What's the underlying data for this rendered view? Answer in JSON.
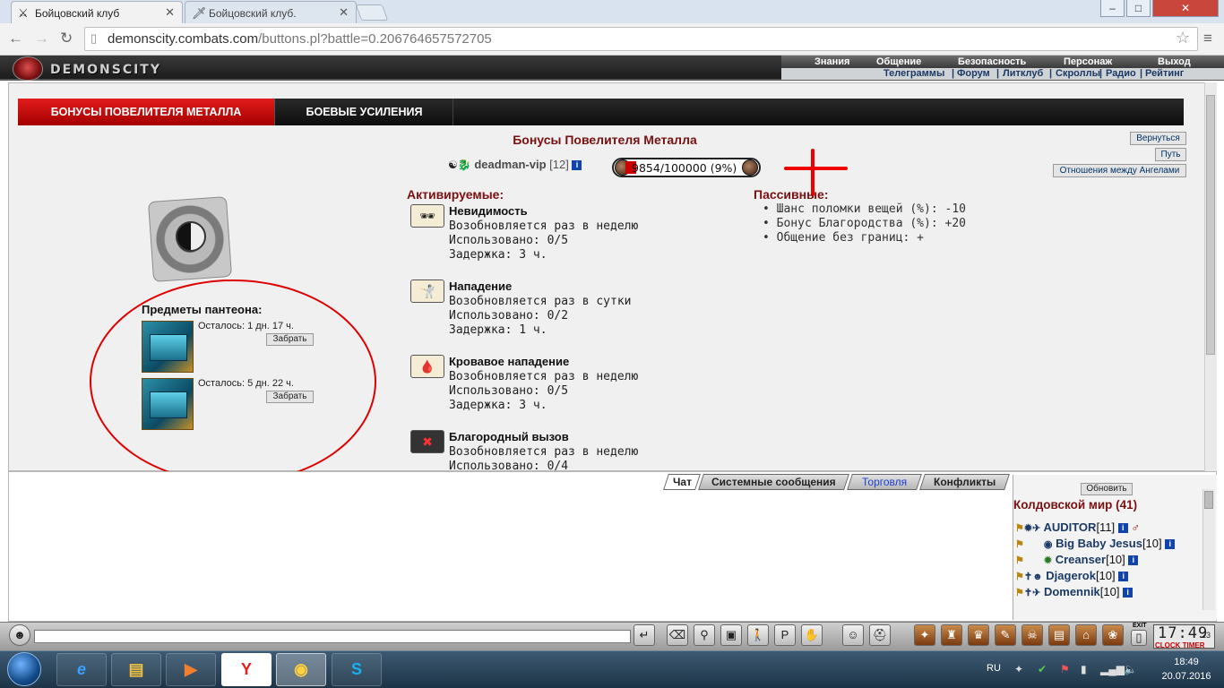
{
  "browser": {
    "tabs": [
      {
        "label": "Бойцовский клуб",
        "icon": "crossed-swords-icon"
      },
      {
        "label": "Бойцовский клуб.",
        "icon": "sword-favicon-icon"
      }
    ],
    "url_host": "demonscity.combats.com",
    "url_path": "/buttons.pl?battle=0.206764657572705",
    "window_controls": {
      "minimize": "–",
      "maximize": "□",
      "close": "✕"
    }
  },
  "site": {
    "logo_text": "DEMONSCITY",
    "menu_top": [
      "Знания",
      "Общение",
      "Безопасность",
      "Персонаж",
      "Выход"
    ],
    "menu_bottom": [
      "Телеграммы",
      "|",
      "Форум",
      "|",
      "Литклуб",
      "|",
      "Скроллы",
      "|",
      "Радио",
      "|",
      "Рейтинг"
    ]
  },
  "panel": {
    "tabs": [
      "БОНУСЫ ПОВЕЛИТЕЛЯ МЕТАЛЛА",
      "БОЕВЫЕ УСИЛЕНИЯ"
    ],
    "title": "Бонусы Повелителя Металла",
    "side_buttons": [
      "Вернуться",
      "Путь",
      "Отношения между Ангелами"
    ],
    "user": {
      "name": "deadman-vip",
      "level": "[12]",
      "info": "i"
    },
    "exp": {
      "text": "9854/100000 (9%)",
      "fraction": 0.09854
    },
    "pantheon_title": "Предметы пантеона:",
    "pantheon_items": [
      {
        "remaining": "Осталось: 1 дн. 17 ч.",
        "button": "Забрать"
      },
      {
        "remaining": "Осталось: 5 дн. 22 ч.",
        "button": "Забрать"
      }
    ],
    "active_heading": "Активируемые:",
    "passive_heading": "Пассивные:",
    "abilities": [
      {
        "name": "Невидимость",
        "renew": "Возобновляется раз в неделю",
        "used": "Использовано: 0/5",
        "delay": "Задержка: 3 ч.",
        "icon": "sunglasses-icon"
      },
      {
        "name": "Нападение",
        "renew": "Возобновляется раз в сутки",
        "used": "Использовано: 0/2",
        "delay": "Задержка: 1 ч.",
        "icon": "attack-icon"
      },
      {
        "name": "Кровавое нападение",
        "renew": "Возобновляется раз в неделю",
        "used": "Использовано: 0/5",
        "delay": "Задержка: 3 ч.",
        "icon": "bloody-attack-icon"
      },
      {
        "name": "Благородный вызов",
        "renew": "Возобновляется раз в неделю",
        "used": "Использовано: 0/4",
        "delay": "",
        "icon": "noble-challenge-icon"
      }
    ],
    "passives": [
      "• Шанс поломки вещей (%): -10",
      "• Бонус Благородства (%): +20",
      "• Общение без границ: +"
    ]
  },
  "chat": {
    "tabs": [
      "Чат",
      "Системные сообщения",
      "Торговля",
      "Конфликты"
    ],
    "accent_trade": "#1f3fd0"
  },
  "online": {
    "refresh": "Обновить",
    "world_title": "Колдовской мир (41)",
    "users": [
      {
        "name": "AUDITOR",
        "level": "[11]"
      },
      {
        "name": "Big Baby Jesus",
        "level": "[10]"
      },
      {
        "name": "Creanser",
        "level": "[10]"
      },
      {
        "name": "Djagerok",
        "level": "[10]"
      },
      {
        "name": "Domennik",
        "level": "[10]"
      }
    ]
  },
  "gamebar": {
    "clock_time": "17:49",
    "clock_seconds": "23",
    "clock_label": "CLOCK TIMER",
    "exit_label": "EXIT"
  },
  "taskbar": {
    "lang": "RU",
    "time": "18:49",
    "date": "20.07.2016"
  },
  "colors": {
    "accent_red": "#c00000",
    "title_maroon": "#7a1010",
    "link_blue": "#1b3a66"
  }
}
